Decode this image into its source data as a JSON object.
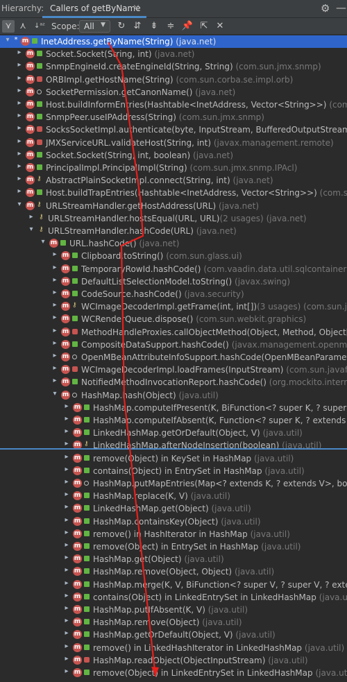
{
  "header": {
    "hierarchy_label": "Hierarchy:",
    "tab_label": "Callers of getByName",
    "tab_close": "×",
    "settings_icon": "gear-icon",
    "hide_icon": "minus-icon"
  },
  "toolbar": {
    "scope_label": "Scope:",
    "scope_value": "All",
    "buttons": [
      "caller-hierarchy-icon",
      "callee-hierarchy-icon",
      "sort-alphabetically-icon",
      "refresh-icon",
      "expand-all-icon",
      "collapse-all-icon",
      "align-icon",
      "pin-icon",
      "export-icon",
      "close-icon"
    ]
  },
  "colors": {
    "background": "#2b2b2b",
    "selection": "#2f65ca",
    "method_icon": "#c75450",
    "public": "#62b543",
    "annotation_arrow": "#e8201c",
    "package_text": "#787878"
  },
  "tree": {
    "rows": [
      {
        "level": 0,
        "arrow": "▾",
        "mark": "*",
        "vis": "pub",
        "name": "InetAddress.getByName(String)",
        "pkg": "(java.net)",
        "selected": true
      },
      {
        "level": 1,
        "arrow": "▸",
        "vis": "pub",
        "name": "Socket.Socket(String, int)",
        "pkg": "(java.net)"
      },
      {
        "level": 1,
        "arrow": "▸",
        "vis": "pub",
        "name": "SnmpEngineId.createEngineId(String, String)",
        "pkg": "(com.sun.jmx.snmp)"
      },
      {
        "level": 1,
        "arrow": "▸",
        "vis": "priv",
        "name": "ORBImpl.getHostName(String)",
        "pkg": "(com.sun.corba.se.impl.orb)"
      },
      {
        "level": 1,
        "arrow": "▸",
        "vis": "pkg",
        "name": "SocketPermission.getCanonName()",
        "pkg": "(java.net)"
      },
      {
        "level": 1,
        "arrow": "▸",
        "vis": "pub",
        "name": "Host.buildInformEntries(Hashtable<InetAddress, Vector<String>>)",
        "pkg": "(com.sun.jmx"
      },
      {
        "level": 1,
        "arrow": "▸",
        "vis": "pub",
        "name": "SnmpPeer.useIPAddress(String)",
        "pkg": "(com.sun.jmx.snmp)"
      },
      {
        "level": 1,
        "arrow": "▸",
        "vis": "priv",
        "name": "SocksSocketImpl.authenticate(byte, InputStream, BufferedOutputStream, long)",
        "pkg": "(ja"
      },
      {
        "level": 1,
        "arrow": "▸",
        "vis": "priv",
        "name": "JMXServiceURL.validateHost(String, int)",
        "pkg": "(javax.management.remote)"
      },
      {
        "level": 1,
        "arrow": "▸",
        "vis": "pub",
        "name": "Socket.Socket(String, int, boolean)",
        "pkg": "(java.net)"
      },
      {
        "level": 1,
        "arrow": "▸",
        "vis": "pub",
        "name": "PrincipalImpl.PrincipalImpl(String)",
        "pkg": "(com.sun.jmx.snmp.IPAcl)"
      },
      {
        "level": 1,
        "arrow": "▸",
        "vis": "key",
        "name": "AbstractPlainSocketImpl.connect(String, int)",
        "pkg": "(java.net)"
      },
      {
        "level": 1,
        "arrow": "▸",
        "vis": "pub",
        "name": "Host.buildTrapEntries(Hashtable<InetAddress, Vector<String>>)",
        "pkg": "(com.sun.jmx.sn"
      },
      {
        "level": 1,
        "arrow": "▾",
        "vis": "key",
        "name": "URLStreamHandler.getHostAddress(URL)",
        "pkg": "(java.net)"
      },
      {
        "level": 2,
        "arrow": "▸",
        "vis": "key",
        "name": "URLStreamHandler.hostsEqual(URL, URL)",
        "usages": "(2 usages)",
        "pkg": "(java.net)",
        "noicon": true
      },
      {
        "level": 2,
        "arrow": "▾",
        "vis": "key",
        "name": "URLStreamHandler.hashCode(URL)",
        "pkg": "(java.net)",
        "noicon": true
      },
      {
        "level": 3,
        "arrow": "▾",
        "vis": "pub",
        "name": "URL.hashCode()",
        "pkg": "(java.net)"
      },
      {
        "level": 4,
        "arrow": "▸",
        "vis": "pub",
        "name": "Clipboard.toString()",
        "pkg": "(com.sun.glass.ui)"
      },
      {
        "level": 4,
        "arrow": "▸",
        "vis": "pub",
        "name": "TemporaryRowId.hashCode()",
        "pkg": "(com.vaadin.data.util.sqlcontainer)"
      },
      {
        "level": 4,
        "arrow": "▸",
        "vis": "pub",
        "name": "DefaultListSelectionModel.toString()",
        "pkg": "(javax.swing)"
      },
      {
        "level": 4,
        "arrow": "▸",
        "vis": "pub",
        "name": "CodeSource.hashCode()",
        "pkg": "(java.security)"
      },
      {
        "level": 4,
        "arrow": "▸",
        "vis": "key",
        "name": "WCImageDecoderImpl.getFrame(int, int[])",
        "usages": "(3 usages)",
        "pkg": "(com.sun.javafx.web"
      },
      {
        "level": 4,
        "arrow": "▸",
        "vis": "pub",
        "name": "WCRenderQueue.dispose()",
        "pkg": "(com.sun.webkit.graphics)"
      },
      {
        "level": 4,
        "arrow": "▸",
        "vis": "priv",
        "name": "MethodHandleProxies.callObjectMethod(Object, Method, Object[])",
        "pkg": "(java"
      },
      {
        "level": 4,
        "arrow": "▸",
        "vis": "pub",
        "name": "CompositeDataSupport.hashCode()",
        "pkg": "(javax.management.openmbean)"
      },
      {
        "level": 4,
        "arrow": "▸",
        "vis": "pkg",
        "name": "OpenMBeanAttributeInfoSupport.hashCode(OpenMBeanParameterInfo)",
        "pkg": ""
      },
      {
        "level": 4,
        "arrow": "▸",
        "vis": "priv",
        "name": "WCImageDecoderImpl.loadFrames(InputStream)",
        "pkg": "(com.sun.javafx.webkit"
      },
      {
        "level": 4,
        "arrow": "▸",
        "vis": "pub",
        "name": "NotifiedMethodInvocationReport.hashCode()",
        "pkg": "(org.mockito.internal.liste"
      },
      {
        "level": 4,
        "arrow": "▾",
        "vis": "pkg",
        "name": "HashMap.hash(Object)",
        "pkg": "(java.util)"
      },
      {
        "level": 5,
        "arrow": "▸",
        "vis": "pub",
        "name": "HashMap.computeIfPresent(K, BiFunction<? super K, ? super V, ? exte",
        "pkg": ""
      },
      {
        "level": 5,
        "arrow": "▸",
        "vis": "pub",
        "name": "HashMap.computeIfAbsent(K, Function<? super K, ? extends V>)",
        "pkg": "(java.u"
      },
      {
        "level": 5,
        "arrow": "▸",
        "vis": "pub",
        "name": "LinkedHashMap.getOrDefault(Object, V)",
        "pkg": "(java.util)"
      },
      {
        "level": 5,
        "arrow": "▸",
        "vis": "key",
        "name": "LinkedHashMap.afterNodeInsertion(boolean)",
        "pkg": "(java.util)"
      },
      {
        "level": 5,
        "arrow": "▸",
        "vis": "pub",
        "name": "remove(Object) in KeySet in HashMap",
        "pkg": "(java.util)"
      },
      {
        "level": 5,
        "arrow": "▸",
        "vis": "pub",
        "name": "contains(Object) in EntrySet in HashMap",
        "pkg": "(java.util)"
      },
      {
        "level": 5,
        "arrow": "▸",
        "vis": "pkg",
        "name": "HashMap.putMapEntries(Map<? extends K, ? extends V>, boolean)",
        "pkg": "(java.u"
      },
      {
        "level": 5,
        "arrow": "▸",
        "vis": "pub",
        "name": "HashMap.replace(K, V)",
        "pkg": "(java.util)"
      },
      {
        "level": 5,
        "arrow": "▸",
        "vis": "pub",
        "name": "LinkedHashMap.get(Object)",
        "pkg": "(java.util)"
      },
      {
        "level": 5,
        "arrow": "▸",
        "vis": "pub",
        "name": "HashMap.containsKey(Object)",
        "pkg": "(java.util)"
      },
      {
        "level": 5,
        "arrow": "▸",
        "vis": "pub",
        "name": "remove() in HashIterator in HashMap",
        "pkg": "(java.util)"
      },
      {
        "level": 5,
        "arrow": "▸",
        "vis": "pub",
        "name": "remove(Object) in EntrySet in HashMap",
        "pkg": "(java.util)"
      },
      {
        "level": 5,
        "arrow": "▸",
        "vis": "pub",
        "name": "HashMap.get(Object)",
        "pkg": "(java.util)"
      },
      {
        "level": 5,
        "arrow": "▸",
        "vis": "pub",
        "name": "HashMap.remove(Object, Object)",
        "pkg": "(java.util)"
      },
      {
        "level": 5,
        "arrow": "▸",
        "vis": "pub",
        "name": "HashMap.merge(K, V, BiFunction<? super V, ? super V, ? extends V>)",
        "pkg": ""
      },
      {
        "level": 5,
        "arrow": "▸",
        "vis": "pub",
        "name": "contains(Object) in LinkedEntrySet in LinkedHashMap",
        "pkg": "(java.util)"
      },
      {
        "level": 5,
        "arrow": "▸",
        "vis": "pub",
        "name": "HashMap.putIfAbsent(K, V)",
        "pkg": "(java.util)"
      },
      {
        "level": 5,
        "arrow": "▸",
        "vis": "pub",
        "name": "HashMap.remove(Object)",
        "pkg": "(java.util)"
      },
      {
        "level": 5,
        "arrow": "▸",
        "vis": "pub",
        "name": "HashMap.getOrDefault(Object, V)",
        "pkg": "(java.util)"
      },
      {
        "level": 5,
        "arrow": "▸",
        "vis": "pub",
        "name": "remove() in LinkedHashIterator in LinkedHashMap",
        "pkg": "(java.util)"
      },
      {
        "level": 5,
        "arrow": "▸",
        "vis": "priv",
        "name": "HashMap.readObject(ObjectInputStream)",
        "pkg": "(java.util)"
      },
      {
        "level": 5,
        "arrow": "▸",
        "vis": "pub",
        "name": "remove(Object) in LinkedEntrySet in LinkedHashMap",
        "pkg": "(java.util)"
      }
    ]
  }
}
